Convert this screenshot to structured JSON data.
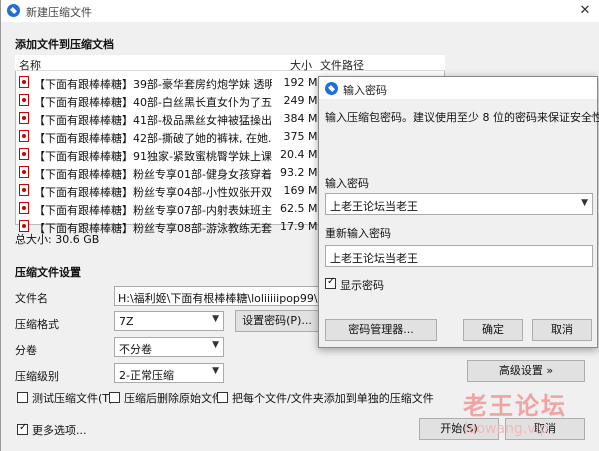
{
  "window": {
    "title": "新建压缩文件",
    "section_add": "添加文件到压缩文档"
  },
  "list": {
    "columns": {
      "name": "名称",
      "size": "大小",
      "path": "文件路径"
    },
    "files": [
      {
        "name": "【下面有跟棒棒糖】39部-豪华套房约炮学妹 透明...",
        "size": "192 MB"
      },
      {
        "name": "【下面有跟棒棒糖】40部-白丝黑长直女仆为了五...",
        "size": "249 MB"
      },
      {
        "name": "【下面有跟棒棒糖】41部-极品黑丝女神被猛操出...",
        "size": "384 MB"
      },
      {
        "name": "【下面有跟棒棒糖】42部-撕破了她的裤袜, 在她...",
        "size": "375 MB"
      },
      {
        "name": "【下面有跟棒棒糖】91独家-紧致蜜桃臀学妹上课...",
        "size": "20.4 MB"
      },
      {
        "name": "【下面有跟棒棒糖】粉丝专享01部-健身女孩穿着l...",
        "size": "93.2 MB"
      },
      {
        "name": "【下面有跟棒棒糖】粉丝专享04部-小性奴张开双...",
        "size": "169 MB"
      },
      {
        "name": "【下面有跟棒棒糖】粉丝专享07部-内射表妹班主...",
        "size": "62.5 MB"
      },
      {
        "name": "【下面有跟棒棒糖】粉丝专享08部-游泳教练无套...",
        "size": "17.9 MB"
      }
    ],
    "total": "总大小: 30.6 GB"
  },
  "settings": {
    "heading": "压缩文件设置",
    "filename_label": "文件名",
    "filename_value": "H:\\福利姬\\下面有根棒棒糖\\loliiiiipop99\\loliiiiipop",
    "format_label": "压缩格式",
    "format_value": "7Z",
    "set_password_btn": "设置密码(P)...",
    "split_label": "分卷",
    "split_value": "不分卷",
    "level_label": "压缩级别",
    "level_value": "2-正常压缩",
    "advanced_btn": "高级设置 »",
    "opt_test": "测试压缩文件(T)",
    "opt_delete": "压缩后删除原始文件",
    "opt_separate": "把每个文件/文件夹添加到单独的压缩文件",
    "more_options": "更多选项...",
    "start_btn": "开始(S)",
    "cancel_btn": "取消"
  },
  "dialog": {
    "title": "输入密码",
    "message": "输入压缩包密码。建议使用至少 8 位的密码来保证安全性。",
    "enter_label": "输入密码",
    "enter_value": "上老王论坛当老王",
    "reenter_label": "重新输入密码",
    "reenter_value": "上老王论坛当老王",
    "show_password": "显示密码",
    "manager_btn": "密码管理器...",
    "ok_btn": "确定",
    "cancel_btn": "取消"
  },
  "watermark": {
    "line1": "老王论坛",
    "line2": "laowang.vip"
  },
  "colors": {
    "accent": "#1e6fd9",
    "watermark": "#f0a3a3"
  }
}
